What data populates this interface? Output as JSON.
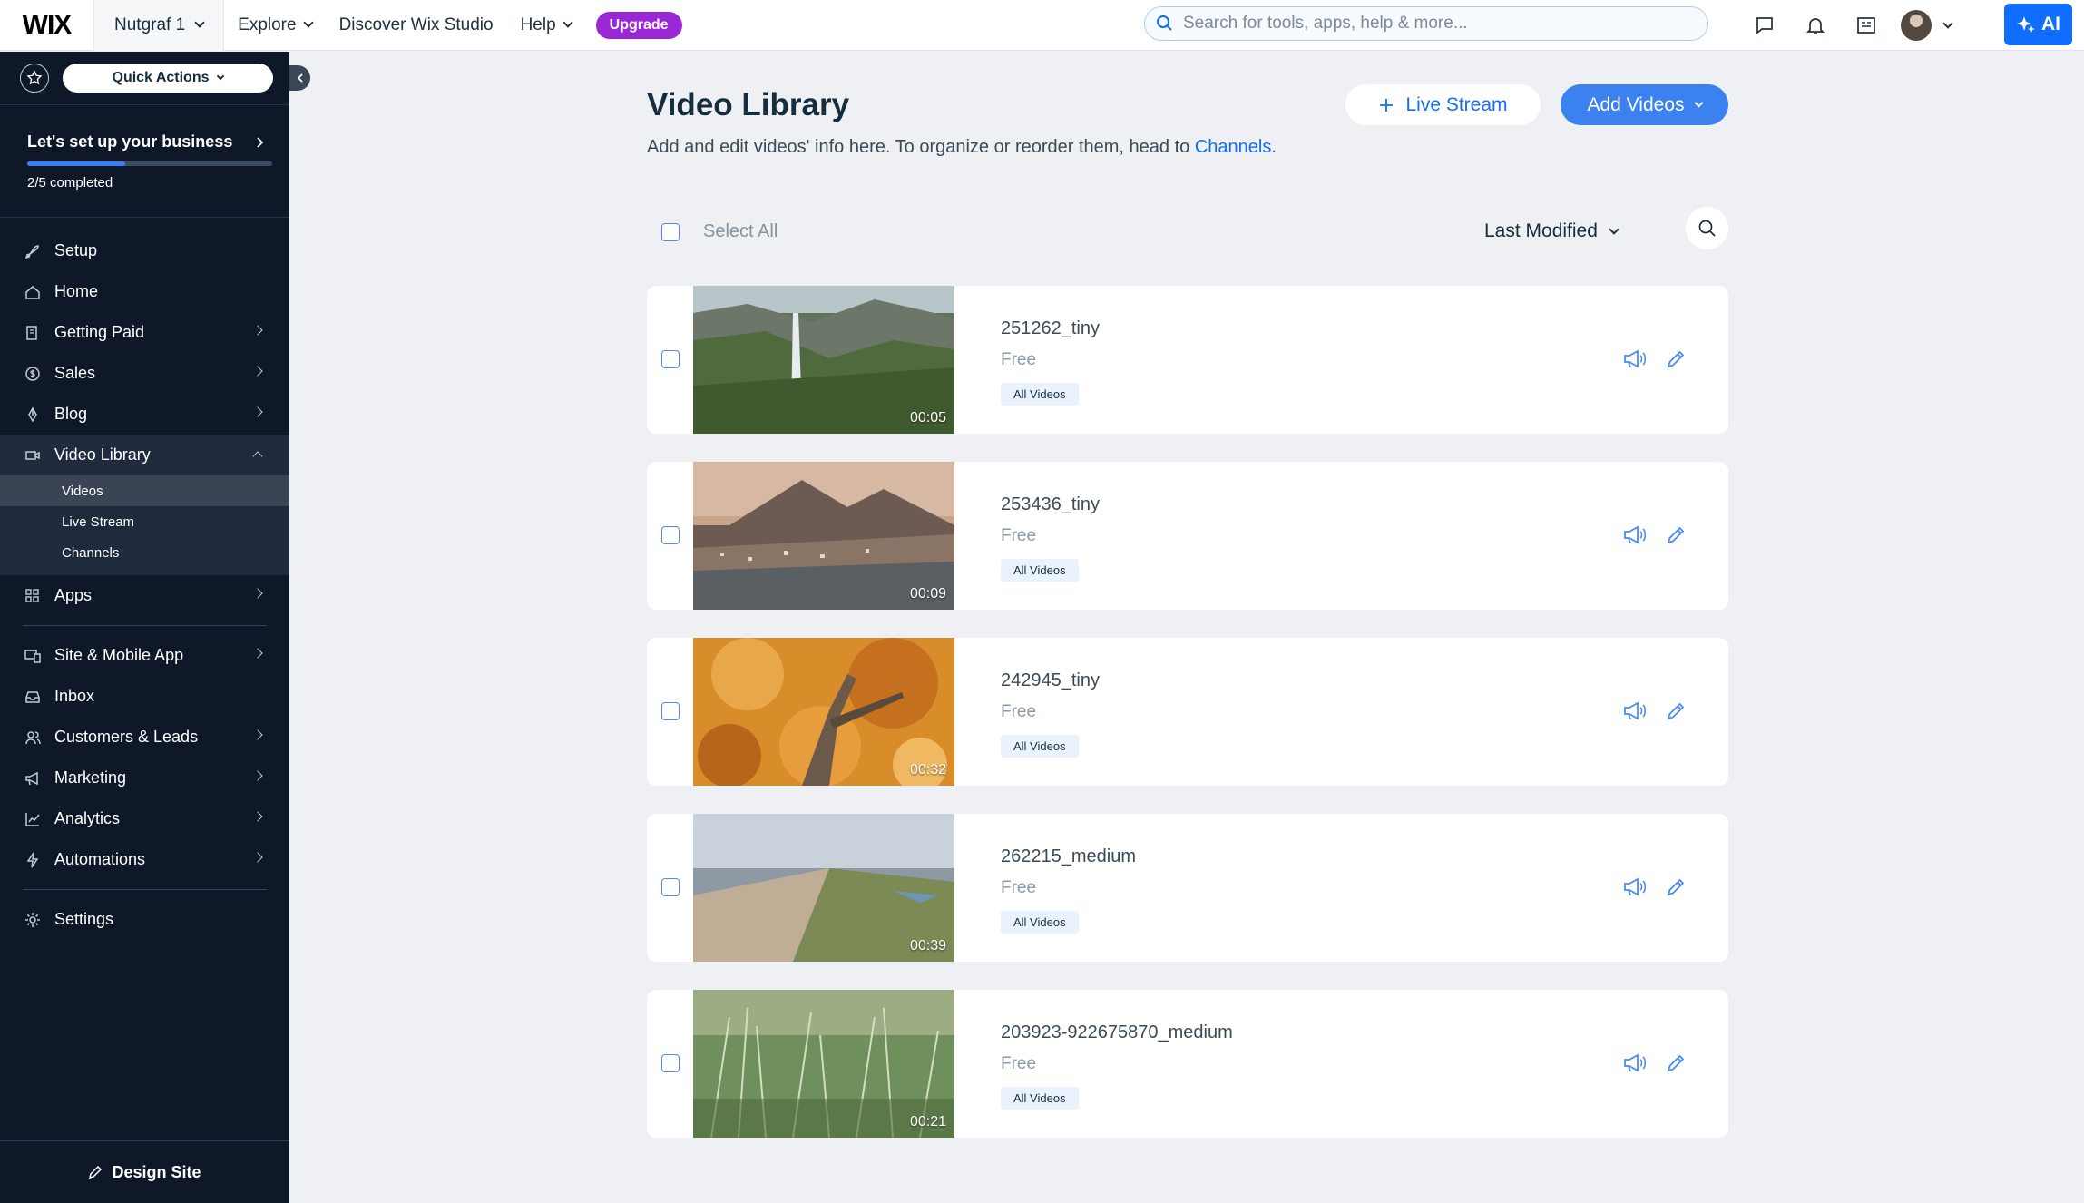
{
  "topbar": {
    "logo": "WIX",
    "site_name": "Nutgraf 1",
    "nav": [
      "Explore",
      "Discover Wix Studio",
      "Help"
    ],
    "upgrade": "Upgrade",
    "search_placeholder": "Search for tools, apps, help & more...",
    "ai_label": "AI"
  },
  "sidebar": {
    "quick_actions": "Quick Actions",
    "setup_title": "Let's set up your business",
    "setup_progress": "2/5 completed",
    "setup_fraction": 0.4,
    "items": [
      {
        "label": "Setup",
        "icon": "rocket-icon",
        "arrow": false
      },
      {
        "label": "Home",
        "icon": "home-icon",
        "arrow": false
      },
      {
        "label": "Getting Paid",
        "icon": "payment-icon",
        "arrow": true
      },
      {
        "label": "Sales",
        "icon": "dollar-icon",
        "arrow": true
      },
      {
        "label": "Blog",
        "icon": "pen-nib-icon",
        "arrow": true
      },
      {
        "label": "Video Library",
        "icon": "video-icon",
        "arrow": true,
        "expanded": true
      },
      {
        "label": "Apps",
        "icon": "apps-icon",
        "arrow": true
      },
      {
        "label": "Site & Mobile App",
        "icon": "devices-icon",
        "arrow": true
      },
      {
        "label": "Inbox",
        "icon": "inbox-icon",
        "arrow": false
      },
      {
        "label": "Customers & Leads",
        "icon": "people-icon",
        "arrow": true
      },
      {
        "label": "Marketing",
        "icon": "megaphone-icon",
        "arrow": true
      },
      {
        "label": "Analytics",
        "icon": "chart-icon",
        "arrow": true
      },
      {
        "label": "Automations",
        "icon": "bolt-icon",
        "arrow": true
      },
      {
        "label": "Settings",
        "icon": "gear-icon",
        "arrow": false
      }
    ],
    "video_sub": [
      "Videos",
      "Live Stream",
      "Channels"
    ],
    "design_site": "Design Site"
  },
  "main": {
    "title": "Video Library",
    "subtitle_prefix": "Add and edit videos' info here. To organize or reorder them, head to ",
    "subtitle_link": "Channels",
    "subtitle_suffix": ".",
    "live_stream": "Live Stream",
    "add_videos": "Add Videos",
    "select_all": "Select All",
    "sort": "Last Modified",
    "videos": [
      {
        "name": "251262_tiny",
        "price": "Free",
        "tag": "All Videos",
        "duration": "00:05"
      },
      {
        "name": "253436_tiny",
        "price": "Free",
        "tag": "All Videos",
        "duration": "00:09"
      },
      {
        "name": "242945_tiny",
        "price": "Free",
        "tag": "All Videos",
        "duration": "00:32"
      },
      {
        "name": "262215_medium",
        "price": "Free",
        "tag": "All Videos",
        "duration": "00:39"
      },
      {
        "name": "203923-922675870_medium",
        "price": "Free",
        "tag": "All Videos",
        "duration": "00:21"
      }
    ]
  },
  "colors": {
    "accent": "#116dff",
    "sidebar_bg": "#0f1829",
    "upgrade": "#9a27d5",
    "page_bg": "#eef0f3"
  }
}
